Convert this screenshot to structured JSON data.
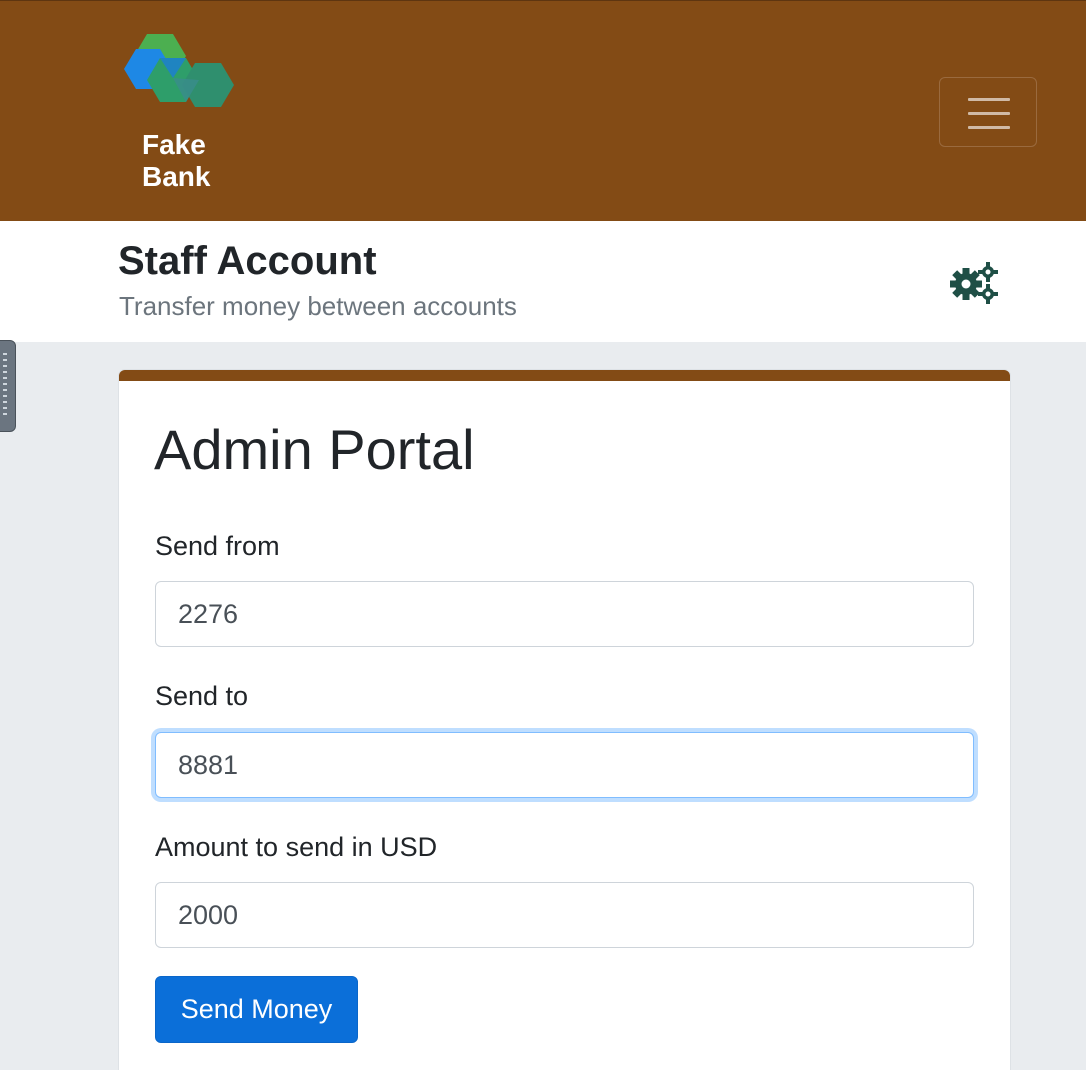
{
  "brand": {
    "name_line1": "Fake",
    "name_line2": "Bank",
    "logo_icon": "hexagon-cubes-logo",
    "color": "#834b15"
  },
  "navbar": {
    "menu_icon": "hamburger-menu-icon"
  },
  "subheader": {
    "title": "Staff Account",
    "subtitle": "Transfer money between accounts",
    "settings_icon": "gears-icon"
  },
  "form": {
    "title": "Admin Portal",
    "send_from": {
      "label": "Send from",
      "value": "2276"
    },
    "send_to": {
      "label": "Send to",
      "value": "8881"
    },
    "amount": {
      "label": "Amount to send in USD",
      "value": "2000"
    },
    "submit_label": "Send Money",
    "accent_color": "#0b6fd9"
  }
}
